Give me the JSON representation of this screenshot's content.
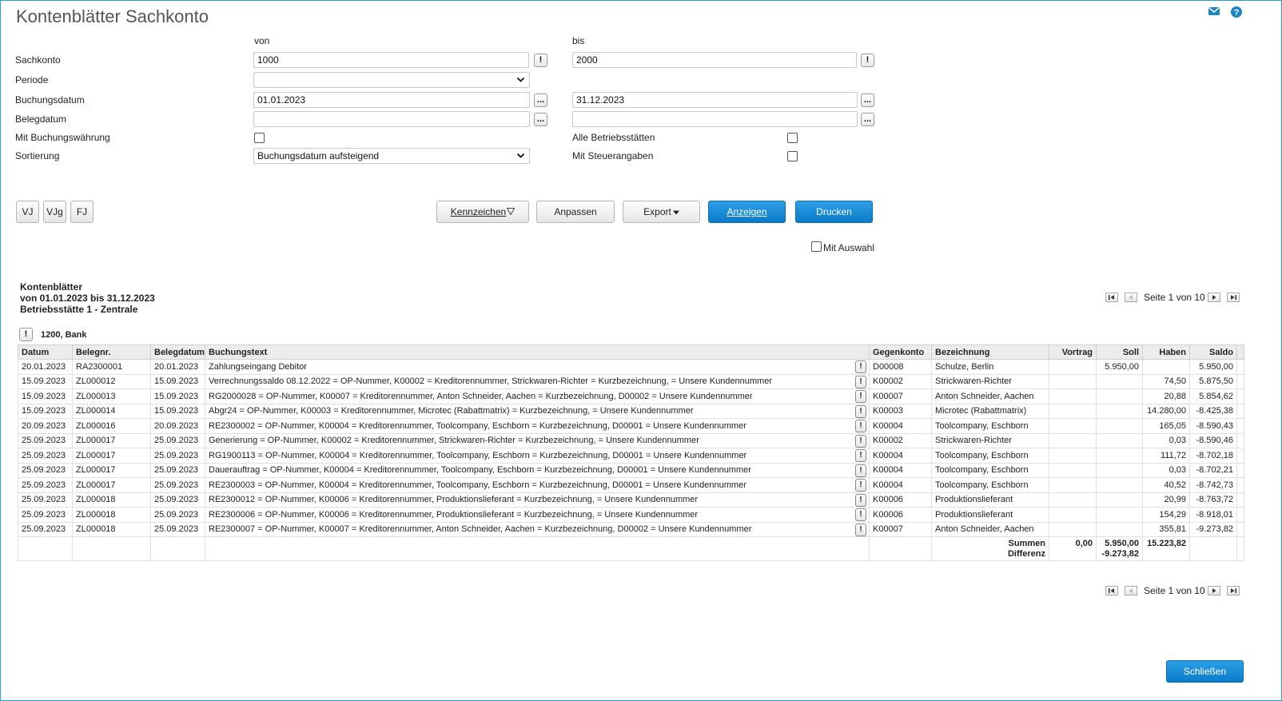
{
  "window": {
    "title": "Kontenblätter Sachkonto"
  },
  "icons": {
    "mail": "mail-icon",
    "help": "help-icon",
    "info": "exclamation-icon"
  },
  "colors": {
    "accent": "#0b7ac8",
    "frame": "#2a9fd6"
  },
  "form": {
    "col_von": "von",
    "col_bis": "bis",
    "sachkonto": {
      "label": "Sachkonto",
      "von": "1000",
      "bis": "2000"
    },
    "periode": {
      "label": "Periode",
      "value": ""
    },
    "buchungsdatum": {
      "label": "Buchungsdatum",
      "von": "01.01.2023",
      "bis": "31.12.2023"
    },
    "belegdatum": {
      "label": "Belegdatum",
      "von": "",
      "bis": ""
    },
    "mit_buchungswaehrung": {
      "label": "Mit Buchungswährung",
      "checked": false
    },
    "alle_betriebsstaetten": {
      "label": "Alle Betriebsstätten",
      "checked": false
    },
    "sortierung": {
      "label": "Sortierung",
      "value": "Buchungsdatum aufsteigend"
    },
    "mit_steuerangaben": {
      "label": "Mit Steuerangaben",
      "checked": false
    },
    "ellipsis": "...",
    "bang": "!"
  },
  "toolbar": {
    "vj": "VJ",
    "vjg": "VJg",
    "fj": "FJ",
    "kennzeichen": "Kennzeichen",
    "anpassen": "Anpassen",
    "export": "Export",
    "anzeigen": "Anzeigen",
    "drucken": "Drucken",
    "mit_auswahl": "Mit Auswahl"
  },
  "report": {
    "line1": "Kontenblätter",
    "line2": "von 01.01.2023 bis 31.12.2023",
    "line3": "Betriebsstätte 1 - Zentrale",
    "pager": "Seite 1 von 10",
    "account": "1200, Bank"
  },
  "table": {
    "headers": [
      "Datum",
      "Belegnr.",
      "Belegdatum",
      "Buchungstext",
      "Gegenkonto",
      "Bezeichnung",
      "Vortrag",
      "Soll",
      "Haben",
      "Saldo"
    ],
    "rows": [
      [
        "20.01.2023",
        "RA2300001",
        "20.01.2023",
        "Zahlungseingang Debitor",
        "D00008",
        "Schulze, Berlin",
        "",
        "5.950,00",
        "",
        "5.950,00"
      ],
      [
        "15.09.2023",
        "ZL000012",
        "15.09.2023",
        "Verrechnungssaldo 08.12.2022 = OP-Nummer, K00002 = Kreditorennummer, Strickwaren-Richter = Kurzbezeichnung, = Unsere Kundennummer",
        "K00002",
        "Strickwaren-Richter",
        "",
        "",
        "74,50",
        "5.875,50"
      ],
      [
        "15.09.2023",
        "ZL000013",
        "15.09.2023",
        "RG2000028 = OP-Nummer, K00007 = Kreditorennummer, Anton Schneider, Aachen = Kurzbezeichnung, D00002 = Unsere Kundennummer",
        "K00007",
        "Anton Schneider, Aachen",
        "",
        "",
        "20,88",
        "5.854,62"
      ],
      [
        "15.09.2023",
        "ZL000014",
        "15.09.2023",
        "Abgr24 = OP-Nummer, K00003 = Kreditorennummer, Microtec (Rabattmatrix) = Kurzbezeichnung, = Unsere Kundennummer",
        "K00003",
        "Microtec (Rabattmatrix)",
        "",
        "",
        "14.280,00",
        "-8.425,38"
      ],
      [
        "20.09.2023",
        "ZL000016",
        "20.09.2023",
        "RE2300002 = OP-Nummer, K00004 = Kreditorennummer, Toolcompany, Eschborn = Kurzbezeichnung, D00001 = Unsere Kundennummer",
        "K00004",
        "Toolcompany, Eschborn",
        "",
        "",
        "165,05",
        "-8.590,43"
      ],
      [
        "25.09.2023",
        "ZL000017",
        "25.09.2023",
        "Generierung = OP-Nummer, K00002 = Kreditorennummer, Strickwaren-Richter = Kurzbezeichnung, = Unsere Kundennummer",
        "K00002",
        "Strickwaren-Richter",
        "",
        "",
        "0,03",
        "-8.590,46"
      ],
      [
        "25.09.2023",
        "ZL000017",
        "25.09.2023",
        "RG1900113 = OP-Nummer, K00004 = Kreditorennummer, Toolcompany, Eschborn = Kurzbezeichnung, D00001 = Unsere Kundennummer",
        "K00004",
        "Toolcompany, Eschborn",
        "",
        "",
        "111,72",
        "-8.702,18"
      ],
      [
        "25.09.2023",
        "ZL000017",
        "25.09.2023",
        "Dauerauftrag = OP-Nummer, K00004 = Kreditorennummer, Toolcompany, Eschborn = Kurzbezeichnung, D00001 = Unsere Kundennummer",
        "K00004",
        "Toolcompany, Eschborn",
        "",
        "",
        "0,03",
        "-8.702,21"
      ],
      [
        "25.09.2023",
        "ZL000017",
        "25.09.2023",
        "RE2300003 = OP-Nummer, K00004 = Kreditorennummer, Toolcompany, Eschborn = Kurzbezeichnung, D00001 = Unsere Kundennummer",
        "K00004",
        "Toolcompany, Eschborn",
        "",
        "",
        "40,52",
        "-8.742,73"
      ],
      [
        "25.09.2023",
        "ZL000018",
        "25.09.2023",
        "RE2300012 = OP-Nummer, K00006 = Kreditorennummer, Produktionslieferant = Kurzbezeichnung, = Unsere Kundennummer",
        "K00006",
        "Produktionslieferant",
        "",
        "",
        "20,99",
        "-8.763,72"
      ],
      [
        "25.09.2023",
        "ZL000018",
        "25.09.2023",
        "RE2300006 = OP-Nummer, K00006 = Kreditorennummer, Produktionslieferant = Kurzbezeichnung, = Unsere Kundennummer",
        "K00006",
        "Produktionslieferant",
        "",
        "",
        "154,29",
        "-8.918,01"
      ],
      [
        "25.09.2023",
        "ZL000018",
        "25.09.2023",
        "RE2300007 = OP-Nummer, K00007 = Kreditorennummer, Anton Schneider, Aachen = Kurzbezeichnung, D00002 = Unsere Kundennummer",
        "K00007",
        "Anton Schneider, Aachen",
        "",
        "",
        "355,81",
        "-9.273,82"
      ]
    ],
    "summen_label": "Summen",
    "differenz_label": "Differenz",
    "summen_vortrag": "0,00",
    "summen_soll": "5.950,00",
    "differenz_soll": "-9.273,82",
    "summen_haben": "15.223,82"
  },
  "footer": {
    "close": "Schließen"
  }
}
